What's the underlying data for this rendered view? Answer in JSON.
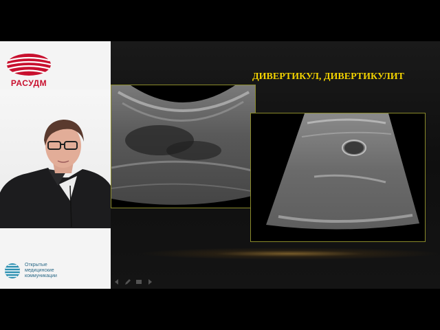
{
  "sidebar": {
    "logo_text": "РАСУДМ",
    "partner": {
      "lines": [
        "Открытые",
        "медицинские",
        "коммуникации"
      ]
    }
  },
  "slide": {
    "title": "ДИВЕРТИКУЛ, ДИВЕРТИКУЛИТ"
  },
  "colors": {
    "title": "#f2d200",
    "logo": "#c8102e",
    "partner": "#2b6a88",
    "frame_border": "#8a8a2a"
  },
  "icons": [
    "prev-arrow-icon",
    "pen-icon",
    "menu-icon",
    "next-arrow-icon"
  ]
}
